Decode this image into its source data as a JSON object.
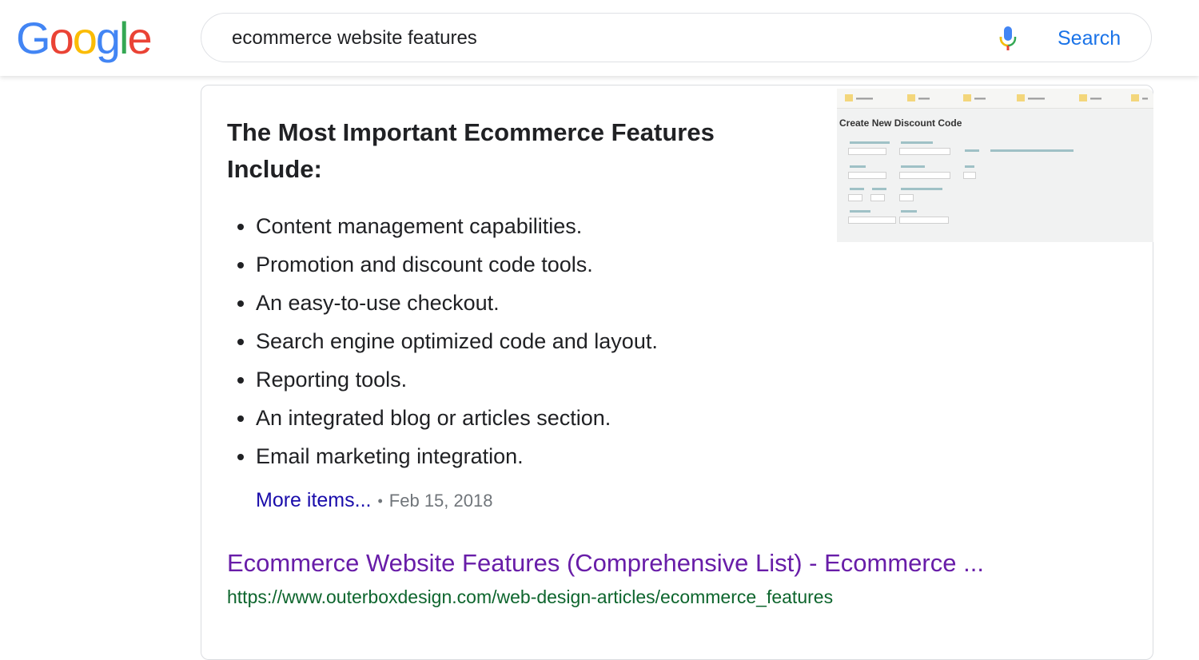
{
  "logo": {
    "text": "Google",
    "letters": [
      "G",
      "o",
      "o",
      "g",
      "l",
      "e"
    ],
    "colors": [
      "#4285f4",
      "#ea4335",
      "#fbbc05",
      "#4285f4",
      "#34a853",
      "#ea4335"
    ]
  },
  "search": {
    "query": "ecommerce website features",
    "button_label": "Search",
    "mic_icon": "microphone-icon"
  },
  "snippet": {
    "title": "The Most Important Ecommerce Features Include:",
    "items": [
      "Content management capabilities.",
      "Promotion and discount code tools.",
      "An easy-to-use checkout.",
      "Search engine optimized code and layout.",
      "Reporting tools.",
      "An integrated blog or articles section.",
      "Email marketing integration."
    ],
    "more_label": "More items...",
    "separator": "•",
    "date": "Feb 15, 2018",
    "thumbnail": {
      "heading": "Create New Discount Code"
    }
  },
  "result": {
    "title": "Ecommerce Website Features (Comprehensive List) - Ecommerce ...",
    "url": "https://www.outerboxdesign.com/web-design-articles/ecommerce_features"
  },
  "colors": {
    "link": "#1a0dab",
    "visited": "#681da8",
    "url": "#0d652d",
    "accent": "#1a73e8"
  }
}
